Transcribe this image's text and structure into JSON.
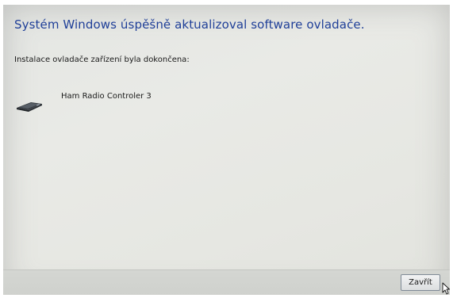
{
  "window": {
    "title": "Systém Windows úspěšně aktualizoval software ovladače."
  },
  "content": {
    "subtitle": "Instalace ovladače zařízení byla dokončena:",
    "device": {
      "name": "Ham Radio Controler 3",
      "icon": "usb-device-icon"
    }
  },
  "footer": {
    "close_label": "Zavřít"
  },
  "colors": {
    "title": "#1f3f98",
    "background": "#e6e7e2",
    "footer": "#d2d4d0"
  }
}
